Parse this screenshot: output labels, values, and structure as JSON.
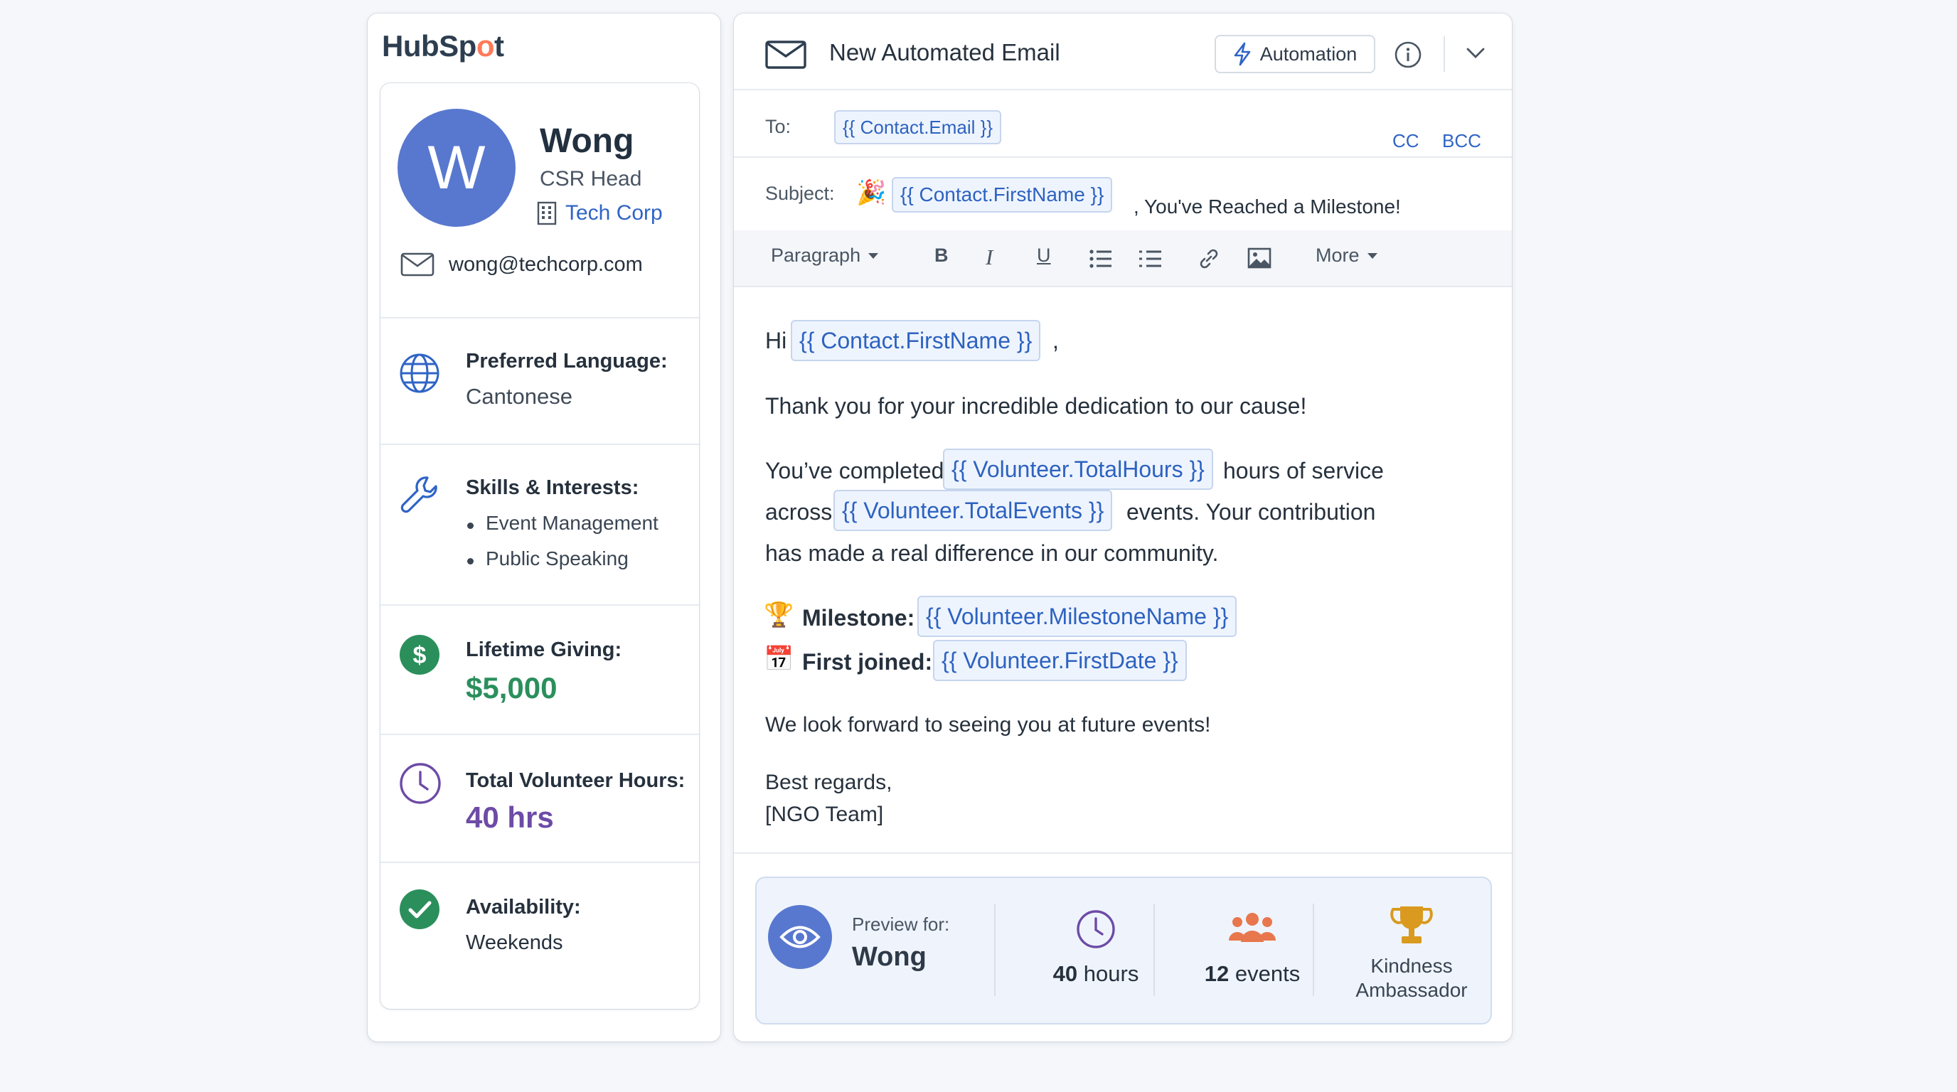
{
  "brand": {
    "logo_text_1": "HubSp",
    "logo_text_2": "o",
    "logo_text_3": "t"
  },
  "contact": {
    "avatar_initial": "W",
    "name": "Wong",
    "role": "CSR Head",
    "company": "Tech Corp",
    "email": "wong@techcorp.com"
  },
  "sections": {
    "language": {
      "title": "Preferred Language:",
      "value": "Cantonese"
    },
    "skills": {
      "title": "Skills & Interests:",
      "items": [
        "Event Management",
        "Public Speaking"
      ]
    },
    "giving": {
      "title": "Lifetime Giving:",
      "value": "$5,000"
    },
    "hours": {
      "title": "Total Volunteer Hours:",
      "value": "40 hrs"
    },
    "availability": {
      "title": "Availability:",
      "value": "Weekends"
    }
  },
  "email": {
    "title": "New Automated Email",
    "automation_label": "Automation",
    "to_label": "To:",
    "to_token": "{{ Contact.Email }}",
    "cc": "CC",
    "bcc": "BCC",
    "subject_label": "Subject:",
    "subject_emoji": "🎉",
    "subject_token": "{{ Contact.FirstName }}",
    "subject_rest": ", You've Reached a Milestone!"
  },
  "toolbar": {
    "paragraph": "Paragraph",
    "bold": "B",
    "italic": "I",
    "underline": "U",
    "more": "More"
  },
  "body": {
    "hi": "Hi",
    "hi_token": "{{ Contact.FirstName }}",
    "hi_comma": ",",
    "thanks": "Thank you for your incredible dedication to our cause!",
    "completed_pre": "You’ve completed",
    "total_hours_token": "{{ Volunteer.TotalHours }}",
    "completed_post": "hours of service",
    "across": "across",
    "total_events_token": "{{ Volunteer.TotalEvents }}",
    "events_post": "events. Your contribution",
    "difference": "has made a real difference in our community.",
    "milestone_emoji": "🏆",
    "milestone_label": "Milestone:",
    "milestone_token": "{{ Volunteer.MilestoneName }}",
    "first_emoji": "📅",
    "first_label": "First joined:",
    "first_token": "{{ Volunteer.FirstDate }}",
    "look_forward": "We look forward to seeing you at future events!",
    "regards": "Best regards,",
    "signature": "[NGO Team]"
  },
  "preview": {
    "label": "Preview for:",
    "name": "Wong",
    "hours_num": "40",
    "hours_unit": "hours",
    "events_num": "12",
    "events_unit": "events",
    "milestone_line1": "Kindness",
    "milestone_line2": "Ambassador"
  },
  "colors": {
    "accent_blue": "#2f64c6",
    "avatar": "#5878cf",
    "money_green": "#2b8f5c",
    "hours_purple": "#6d4ba6",
    "events_orange": "#e8774d",
    "trophy_gold": "#d99a1f",
    "hubspot_orange": "#ff7a59"
  }
}
